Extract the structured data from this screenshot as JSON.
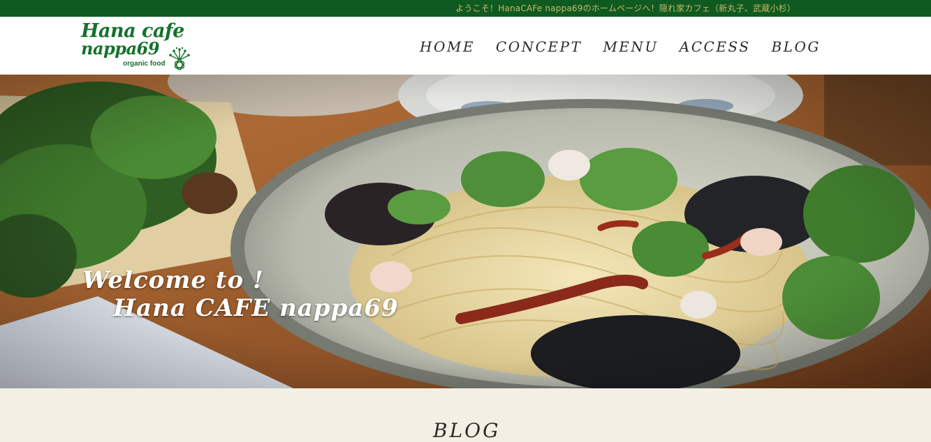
{
  "topbar": {
    "welcome_text": "ようこそ！HanaCAFe nappa69のホームページへ！隠れ家カフェ（新丸子、武蔵小杉）"
  },
  "logo": {
    "line1": "Hana cafe",
    "line2": "nappa69",
    "sub": "organic food",
    "brand_color": "#15712d"
  },
  "nav": {
    "items": [
      {
        "label": "HOME"
      },
      {
        "label": "CONCEPT"
      },
      {
        "label": "MENU"
      },
      {
        "label": "ACCESS"
      },
      {
        "label": "BLOG"
      }
    ]
  },
  "hero": {
    "line1": "Welcome to !",
    "line2": "Hana CAFE nappa69"
  },
  "section": {
    "title": "BLOG"
  },
  "colors": {
    "topbar_bg": "#0f5a20",
    "topbar_text": "#c9b86a",
    "nav_text": "#2d2a26",
    "section_bg": "#f3efe4"
  }
}
